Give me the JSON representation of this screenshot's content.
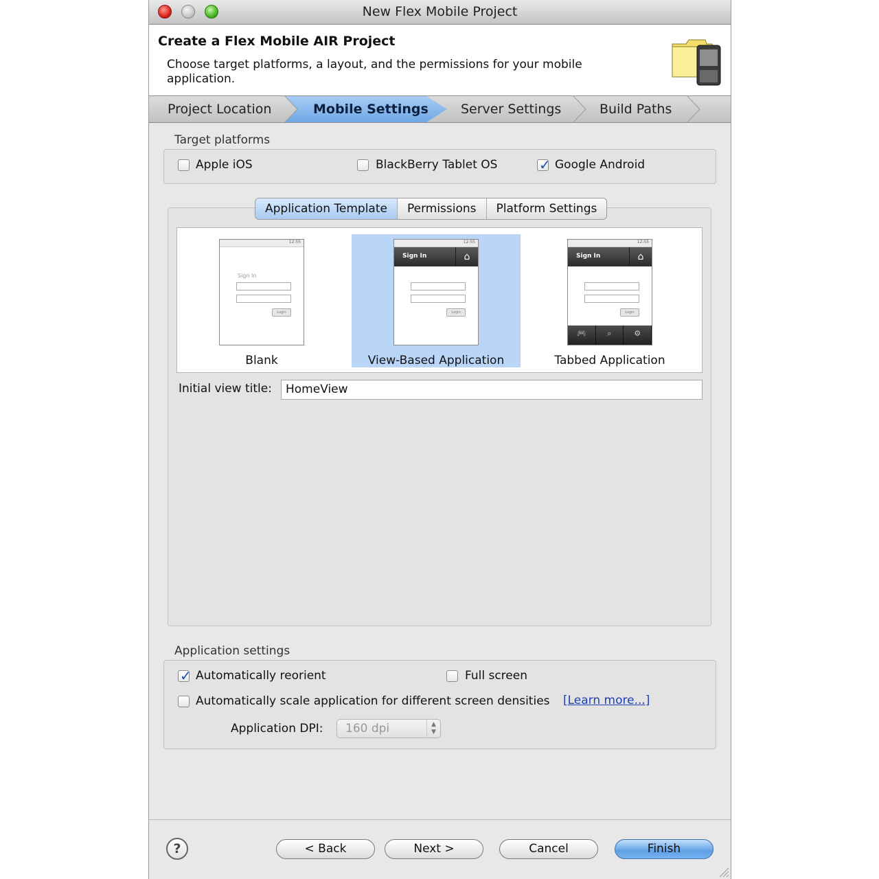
{
  "window": {
    "title": "New Flex Mobile Project"
  },
  "header": {
    "title": "Create a Flex Mobile AIR Project",
    "description": "Choose target platforms, a layout, and the permissions for your mobile application."
  },
  "steps": [
    "Project Location",
    "Mobile Settings",
    "Server Settings",
    "Build Paths"
  ],
  "target_platforms": {
    "label": "Target platforms",
    "options": [
      {
        "label": "Apple iOS",
        "checked": false
      },
      {
        "label": "BlackBerry Tablet OS",
        "checked": false
      },
      {
        "label": "Google Android",
        "checked": true
      }
    ]
  },
  "tabs": [
    "Application Template",
    "Permissions",
    "Platform Settings"
  ],
  "templates": {
    "items": [
      "Blank",
      "View-Based Application",
      "Tabbed Application"
    ],
    "selected": "View-Based Application",
    "preview": {
      "status": "12:55",
      "signin": "Sign In",
      "button": "Login"
    }
  },
  "initial_view": {
    "label": "Initial view title:",
    "value": "HomeView"
  },
  "app_settings": {
    "label": "Application settings",
    "auto_reorient": {
      "label": "Automatically reorient",
      "checked": true
    },
    "full_screen": {
      "label": "Full screen",
      "checked": false
    },
    "auto_scale": {
      "label": "Automatically scale application for different screen densities",
      "checked": false
    },
    "learn_more": "[Learn more...]",
    "dpi_label": "Application DPI:",
    "dpi_value": "160 dpi"
  },
  "buttons": {
    "back": "< Back",
    "next": "Next >",
    "cancel": "Cancel",
    "finish": "Finish",
    "help": "?"
  },
  "colors": {
    "selection": "#b9d6f9",
    "active_step": "#6fa7e6",
    "link": "#1f3fb5"
  }
}
